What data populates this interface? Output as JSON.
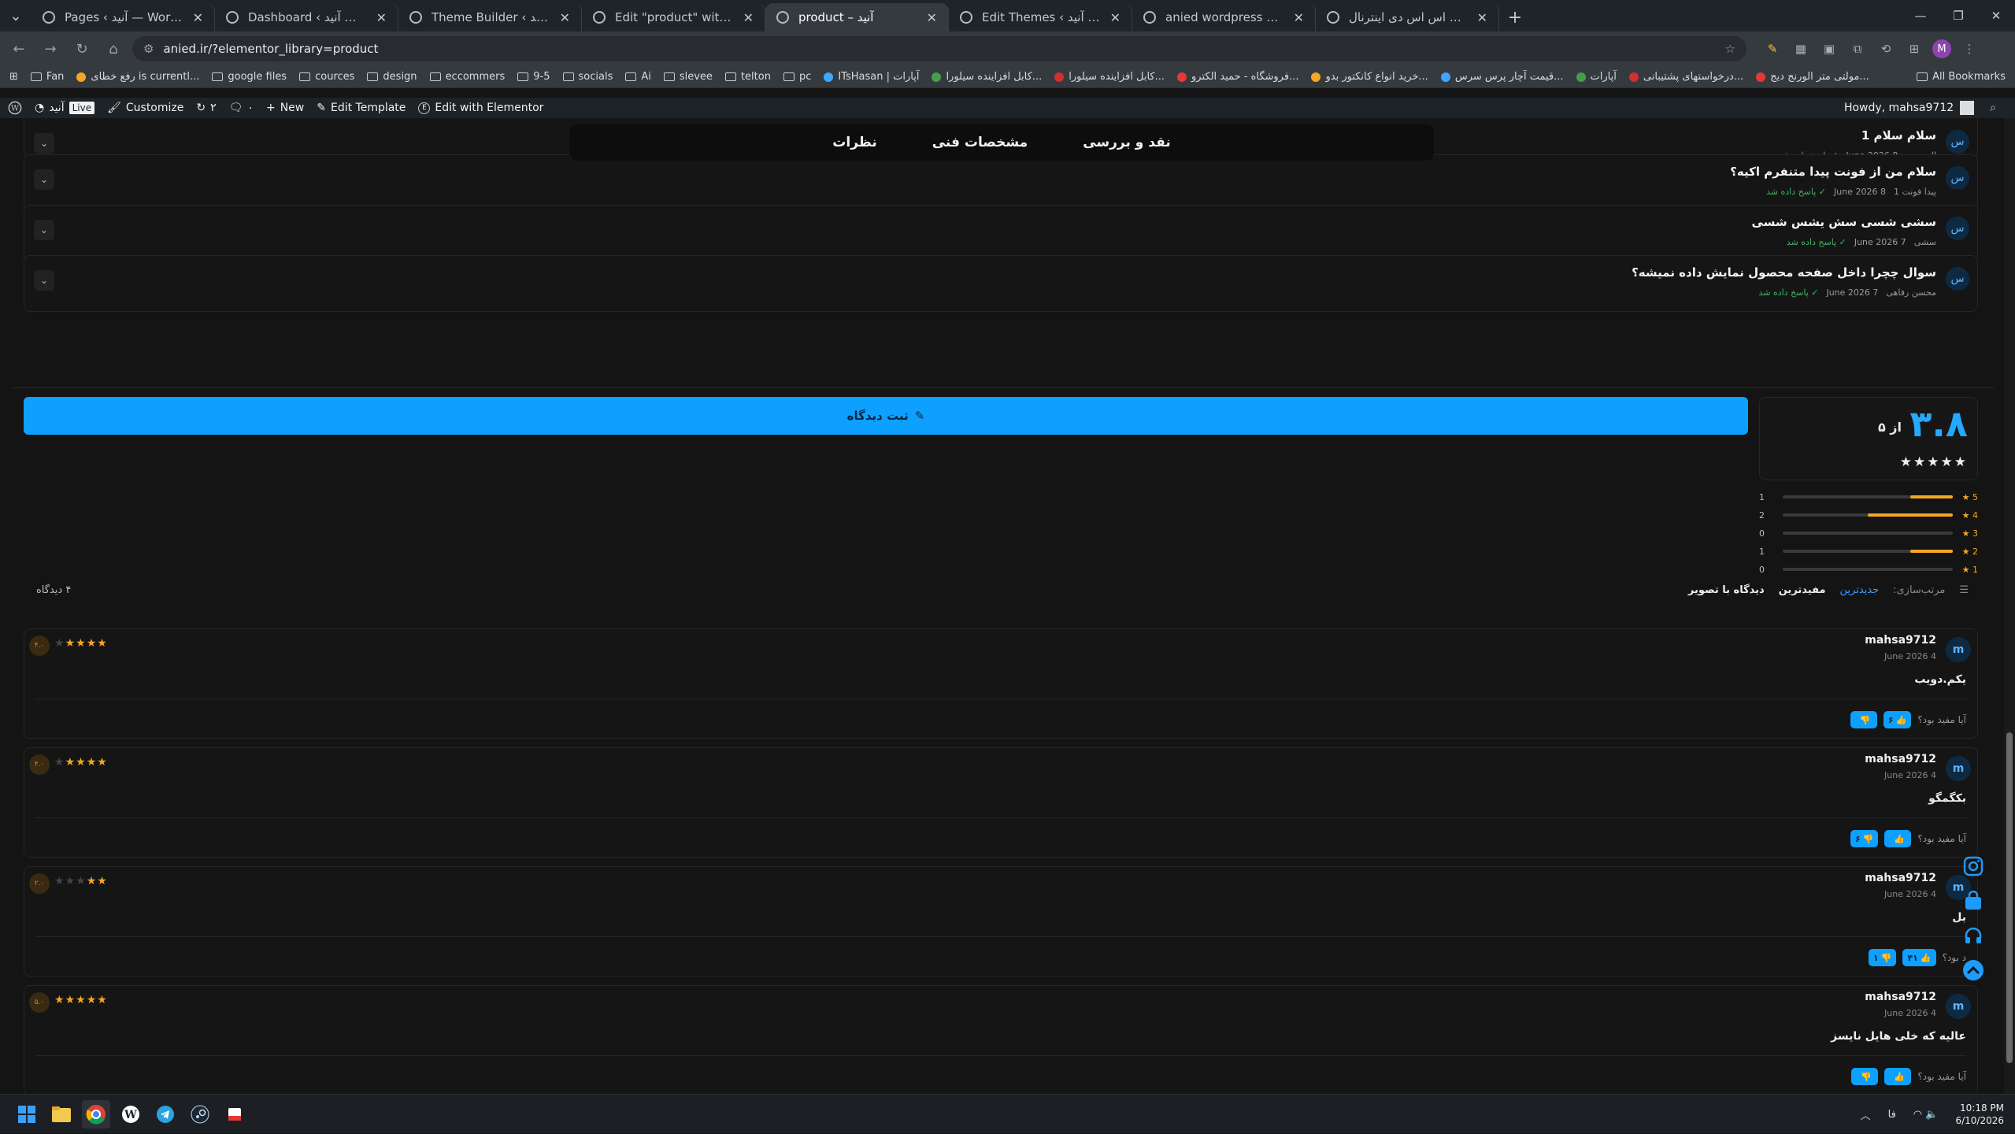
{
  "browser": {
    "tabs": [
      {
        "title": "Pages ‹ آنید — WordPress",
        "active": false
      },
      {
        "title": "Dashboard ‹ آنید — WordPress",
        "active": false
      },
      {
        "title": "Theme Builder ‹ آنید — WordPress",
        "active": false
      },
      {
        "title": "Edit \"product\" with Elementor",
        "active": false
      },
      {
        "title": "product – آنید",
        "active": true
      },
      {
        "title": "Edit Themes ‹ آنید — WordPress",
        "active": false
      },
      {
        "title": "anied wordpress codes - Claude",
        "active": false
      },
      {
        "title": "قیمت و خرید اس اس دی اینترنال",
        "active": false
      }
    ],
    "url": "anied.ir/?elementor_library=product",
    "bookmarks": [
      {
        "label": "Fan",
        "kind": "folder"
      },
      {
        "label": "رفع خطای is currentl...",
        "kind": "site"
      },
      {
        "label": "google files",
        "kind": "folder"
      },
      {
        "label": "cources",
        "kind": "folder"
      },
      {
        "label": "design",
        "kind": "folder"
      },
      {
        "label": "eccommers",
        "kind": "folder"
      },
      {
        "label": "9-5",
        "kind": "folder"
      },
      {
        "label": "socials",
        "kind": "folder"
      },
      {
        "label": "Ai",
        "kind": "folder"
      },
      {
        "label": "slevee",
        "kind": "folder"
      },
      {
        "label": "telton",
        "kind": "folder"
      },
      {
        "label": "pc",
        "kind": "folder"
      },
      {
        "label": "ITsHasan | آپارات",
        "kind": "site"
      },
      {
        "label": "کابل افزاینده سیلورا...",
        "kind": "site"
      },
      {
        "label": "کابل افزاینده سیلورا...",
        "kind": "site"
      },
      {
        "label": "فروشگاه - حمید الکترو...",
        "kind": "site"
      },
      {
        "label": "خرید انواع کانکتور بدو...",
        "kind": "site"
      },
      {
        "label": "قیمت آچار پرس سرس...",
        "kind": "site"
      },
      {
        "label": "آپارات",
        "kind": "site"
      },
      {
        "label": "درخواستهای پشتیبانی...",
        "kind": "site"
      },
      {
        "label": "مولتی متر الورنج دیج...",
        "kind": "site"
      }
    ],
    "all_bookmarks": "All Bookmarks",
    "profile_initial": "M"
  },
  "adminbar": {
    "site": "آنید",
    "live": "Live",
    "customize": "Customize",
    "updates": "۲",
    "comments": "۰",
    "new": "New",
    "edit_template": "Edit Template",
    "edit_elementor": "Edit with Elementor",
    "howdy": "Howdy, mahsa9712"
  },
  "product_tabs": [
    "نقد و بررسی",
    "مشخصات فنی",
    "نظرات"
  ],
  "questions": [
    {
      "avatar": "س",
      "title": "سلام سلام 1",
      "author": "الوووووو",
      "date": "8 June 2026",
      "status": "✓ پاسخ داده شد"
    },
    {
      "avatar": "س",
      "title": "سلام من از فونت پیدا متنفرم اکیه؟",
      "author": "پیدا فونت 1",
      "date": "8 June 2026",
      "status": "✓ پاسخ داده شد"
    },
    {
      "avatar": "س",
      "title": "سشی شسی سش یشس شسی",
      "author": "سشی",
      "date": "7 June 2026",
      "status": "✓ پاسخ داده شد"
    },
    {
      "avatar": "س",
      "title": "سوال چچرا داخل صفحه محصول نمایش داده نمیشه؟",
      "author": "محسن رفاهی",
      "date": "7 June 2026",
      "status": "✓ پاسخ داده شد"
    }
  ],
  "submit_review_label": "ثبت دیدگاه",
  "rating_summary": {
    "score": "۳.۸",
    "out_of": "از ۵",
    "stars": "★★★★★",
    "distribution": [
      {
        "label": "★ 5",
        "count": "1",
        "fill": 0.25
      },
      {
        "label": "★ 4",
        "count": "2",
        "fill": 0.5
      },
      {
        "label": "★ 3",
        "count": "0",
        "fill": 0
      },
      {
        "label": "★ 2",
        "count": "1",
        "fill": 0.25
      },
      {
        "label": "★ 1",
        "count": "0",
        "fill": 0
      }
    ]
  },
  "sort": {
    "label": "مرتب‌سازی:",
    "options": [
      "جدیدترین",
      "مفیدترین",
      "دیدگاه با تصویر"
    ],
    "active": 0,
    "count": "۴ دیدگاه"
  },
  "reviews": [
    {
      "avatar": "m",
      "user": "mahsa9712",
      "date": "4 June 2026",
      "text": "یکم.دویب",
      "stars": 4,
      "badge": "۴.۰",
      "helpful_q": "آیا مفید بود؟",
      "likes": "۶",
      "dislikes": ""
    },
    {
      "avatar": "m",
      "user": "mahsa9712",
      "date": "4 June 2026",
      "text": "بکگمگو",
      "stars": 4,
      "badge": "۴.۰",
      "helpful_q": "آیا مفید بود؟",
      "likes": "",
      "dislikes": "۶"
    },
    {
      "avatar": "m",
      "user": "mahsa9712",
      "date": "4 June 2026",
      "text": "بل",
      "stars": 2,
      "badge": "۲.۰",
      "helpful_q": "د بود؟",
      "likes": "۴۱",
      "dislikes": "۱"
    },
    {
      "avatar": "m",
      "user": "mahsa9712",
      "date": "4 June 2026",
      "text": "عالیه که خلی هایل نایسز",
      "stars": 5,
      "badge": "۵.۰",
      "helpful_q": "آیا مفید بود؟",
      "likes": "",
      "dislikes": ""
    }
  ],
  "social": [
    "instagram-icon",
    "bag-icon",
    "headphones-icon",
    "scroll-top-icon"
  ],
  "clock": {
    "time": "10:18 PM",
    "date": "6/10/2026"
  },
  "tray_lang": "فا"
}
